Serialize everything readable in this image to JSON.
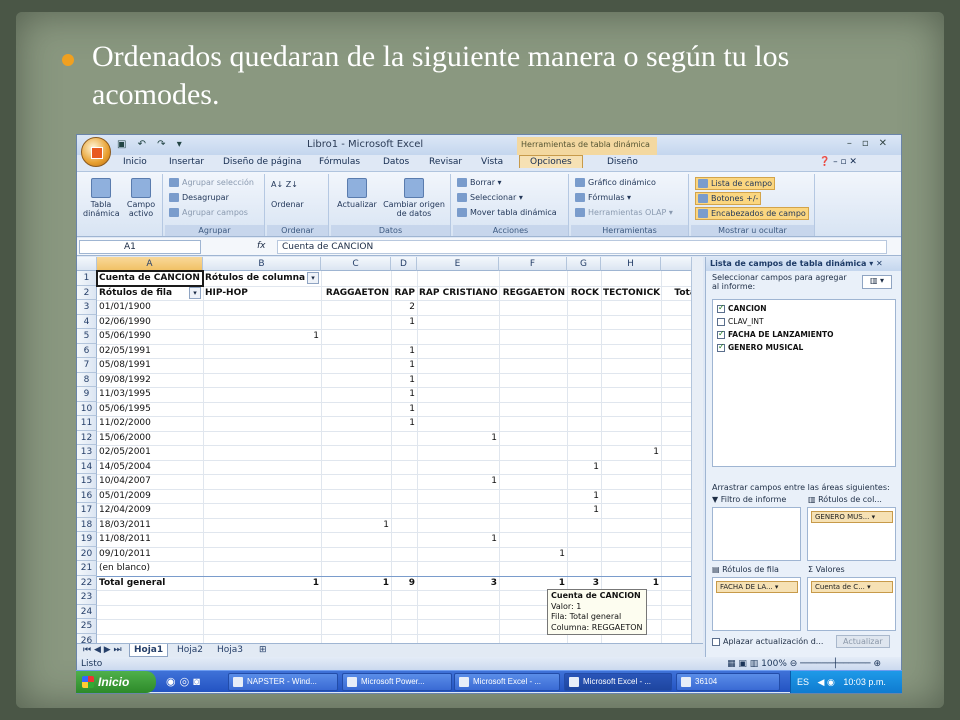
{
  "slide": {
    "bullet": "Ordenados quedaran de la siguiente manera o según tu los acomodes."
  },
  "window": {
    "title": "Libro1 - Microsoft Excel",
    "context_tab_title": "Herramientas de tabla dinámica"
  },
  "tabs": [
    "Inicio",
    "Insertar",
    "Diseño de página",
    "Fórmulas",
    "Datos",
    "Revisar",
    "Vista",
    "Opciones",
    "Diseño"
  ],
  "active_tab": "Opciones",
  "ribbon": {
    "tabla_dinamica": "Tabla dinámica",
    "campo_activo": "Campo activo",
    "agrupar_seleccion": "Agrupar selección",
    "desagrupar": "Desagrupar",
    "agrupar_campos": "Agrupar campos",
    "agrupar_label": "Agrupar",
    "ordenar": "Ordenar",
    "ordenar_label": "Ordenar",
    "actualizar": "Actualizar",
    "cambiar_origen": "Cambiar origen de datos",
    "datos_label": "Datos",
    "borrar": "Borrar",
    "seleccionar": "Seleccionar",
    "mover_tabla": "Mover tabla dinámica",
    "acciones_label": "Acciones",
    "grafico_dinamico": "Gráfico dinámico",
    "formulas": "Fórmulas",
    "herramientas_olap": "Herramientas OLAP",
    "herramientas_label": "Herramientas",
    "lista_de_campo": "Lista de campo",
    "botones": "Botones +/-",
    "encabezados": "Encabezados de campo",
    "mostrar_label": "Mostrar u ocultar"
  },
  "formula_bar": {
    "name_box": "A1",
    "fx": "fx",
    "value": "Cuenta de CANCION"
  },
  "columns": [
    "A",
    "B",
    "C",
    "D",
    "E",
    "F",
    "G",
    "H"
  ],
  "row_numbers": [
    "1",
    "2",
    "3",
    "4",
    "5",
    "6",
    "7",
    "8",
    "9",
    "10",
    "11",
    "12",
    "13",
    "14",
    "15",
    "16",
    "17",
    "18",
    "19",
    "20",
    "21",
    "22",
    "23",
    "24",
    "25",
    "26"
  ],
  "pivot": {
    "a1": "Cuenta de CANCION",
    "b1": "Rótulos de columna",
    "row_label_header": "Rótulos de fila",
    "col_headers": [
      "HIP-HOP",
      "RAGGAETON",
      "RAP",
      "RAP CRISTIANO",
      "REGGAETON",
      "ROCK",
      "TECTONICK",
      "Total"
    ],
    "rows": [
      {
        "label": "01/01/1900",
        "col": 2,
        "value": "2"
      },
      {
        "label": "02/06/1990",
        "col": 2,
        "value": "1"
      },
      {
        "label": "05/06/1990",
        "col": 0,
        "value": "1"
      },
      {
        "label": "02/05/1991",
        "col": 2,
        "value": "1"
      },
      {
        "label": "05/08/1991",
        "col": 2,
        "value": "1"
      },
      {
        "label": "09/08/1992",
        "col": 2,
        "value": "1"
      },
      {
        "label": "11/03/1995",
        "col": 2,
        "value": "1"
      },
      {
        "label": "05/06/1995",
        "col": 2,
        "value": "1"
      },
      {
        "label": "11/02/2000",
        "col": 2,
        "value": "1"
      },
      {
        "label": "15/06/2000",
        "col": 3,
        "value": "1"
      },
      {
        "label": "02/05/2001",
        "col": 6,
        "value": "1"
      },
      {
        "label": "14/05/2004",
        "col": 5,
        "value": "1"
      },
      {
        "label": "10/04/2007",
        "col": 3,
        "value": "1"
      },
      {
        "label": "05/01/2009",
        "col": 5,
        "value": "1"
      },
      {
        "label": "12/04/2009",
        "col": 5,
        "value": "1"
      },
      {
        "label": "18/03/2011",
        "col": 1,
        "value": "1"
      },
      {
        "label": "11/08/2011",
        "col": 3,
        "value": "1"
      },
      {
        "label": "09/10/2011",
        "col": 4,
        "value": "1"
      },
      {
        "label": "(en blanco)",
        "col": -1,
        "value": ""
      }
    ],
    "total_label": "Total general",
    "totals": [
      "1",
      "1",
      "9",
      "3",
      "1",
      "3",
      "1"
    ]
  },
  "tooltip": {
    "line1": "Cuenta de CANCION",
    "line2": "Valor: 1",
    "line3": "Fila: Total general",
    "line4": "Columna: REGGAETON"
  },
  "sheet_tabs": [
    "Hoja1",
    "Hoja2",
    "Hoja3"
  ],
  "status": {
    "text": "Listo",
    "zoom": "100%"
  },
  "field_list": {
    "title": "Lista de campos de tabla dinámica",
    "instructions": "Seleccionar campos para agregar al informe:",
    "fields": [
      {
        "name": "CANCION",
        "checked": true
      },
      {
        "name": "CLAV_INT",
        "checked": false
      },
      {
        "name": "FACHA DE LANZAMIENTO",
        "checked": true
      },
      {
        "name": "GENERO MUSICAL",
        "checked": true
      }
    ],
    "drag_text": "Arrastrar campos entre las áreas siguientes:",
    "filter_label": "Filtro de informe",
    "col_label": "Rótulos de col...",
    "row_label": "Rótulos de fila",
    "values_label": "Valores",
    "col_chip": "GENERO MUS...",
    "row_chip": "FACHA DE LA...",
    "values_chip": "Cuenta de C...",
    "defer": "Aplazar actualización d...",
    "update_btn": "Actualizar"
  },
  "taskbar": {
    "start": "Inicio",
    "items": [
      "NAPSTER - Wind...",
      "Microsoft Power...",
      "Microsoft Excel - ...",
      "Microsoft Excel - ...",
      "36104"
    ],
    "lang": "ES",
    "clock": "10:03 p.m."
  }
}
